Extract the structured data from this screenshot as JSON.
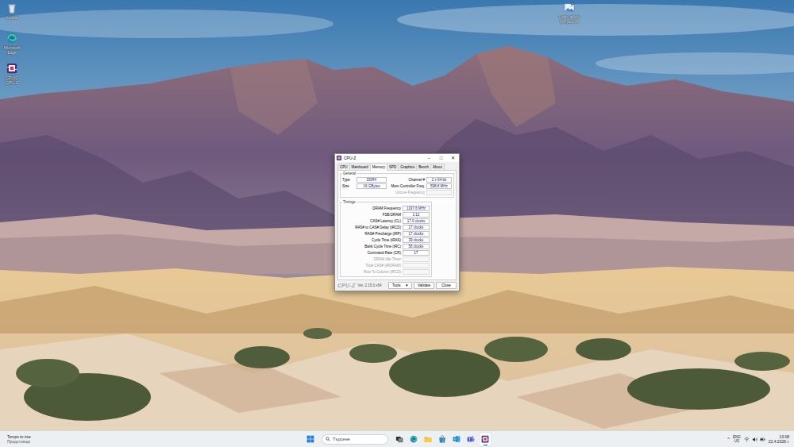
{
  "desktop": {
    "icons": [
      {
        "label": "Кошче",
        "kind": "recycle-bin"
      },
      {
        "label": "Microsoft Edge",
        "kind": "edge"
      },
      {
        "label": "CPUID CPU-Z",
        "kind": "cpuz"
      }
    ],
    "spotlight": {
      "label": "Learn about this picture"
    }
  },
  "window": {
    "title": "CPU-Z",
    "controls": [
      "–",
      "□",
      "✕"
    ]
  },
  "tabs": [
    {
      "label": "CPU",
      "selected": false
    },
    {
      "label": "Mainboard",
      "selected": false
    },
    {
      "label": "Memory",
      "selected": true
    },
    {
      "label": "SPD",
      "selected": false
    },
    {
      "label": "Graphics",
      "selected": false
    },
    {
      "label": "Bench",
      "selected": false
    },
    {
      "label": "About",
      "selected": false
    }
  ],
  "general": {
    "title": "General",
    "pairs": [
      {
        "left": {
          "label": "Type",
          "value": "DDR4"
        },
        "right": {
          "label": "Channel #",
          "value": "2 x 64-bit"
        }
      },
      {
        "left": {
          "label": "Size",
          "value": "16 GBytes"
        },
        "right": {
          "label": "Mem Controller Freq.",
          "value": "598.8 MHz"
        }
      }
    ],
    "extra": {
      "label": "Uncore Frequency",
      "value": "",
      "disabled": true
    }
  },
  "timings": {
    "title": "Timings",
    "rows": [
      {
        "label": "DRAM Frequency",
        "value": "1197.6 MHz",
        "disabled": false
      },
      {
        "label": "FSB:DRAM",
        "value": "1:12",
        "disabled": false
      },
      {
        "label": "CAS# Latency (CL)",
        "value": "17.0 clocks",
        "disabled": false
      },
      {
        "label": "RAS# to CAS# Delay (tRCD)",
        "value": "17 clocks",
        "disabled": false
      },
      {
        "label": "RAS# Precharge (tRP)",
        "value": "17 clocks",
        "disabled": false
      },
      {
        "label": "Cycle Time (tRAS)",
        "value": "39 clocks",
        "disabled": false
      },
      {
        "label": "Bank Cycle Time (tRC)",
        "value": "56 clocks",
        "disabled": false
      },
      {
        "label": "Command Rate (CR)",
        "value": "1T",
        "disabled": false
      },
      {
        "label": "DRAM Idle Timer",
        "value": "",
        "disabled": true
      },
      {
        "label": "Total CAS# (tRDRAM)",
        "value": "",
        "disabled": true
      },
      {
        "label": "Row To Column (tRCD)",
        "value": "",
        "disabled": true
      }
    ]
  },
  "footer": {
    "brand": "CPU-Z",
    "version": "Ver. 2.15.0.x64",
    "buttons": [
      {
        "label": "Tools",
        "arrow": "▾"
      },
      {
        "label": "Validate",
        "arrow": ""
      },
      {
        "label": "Close",
        "arrow": ""
      }
    ]
  },
  "taskbar": {
    "weather": {
      "title": "Temps to rise",
      "subtitle": "Предстоящо"
    },
    "search": {
      "placeholder": "Търсене"
    },
    "apps": [
      {
        "kind": "task-view",
        "running": false,
        "active": false
      },
      {
        "kind": "edge",
        "running": false,
        "active": false
      },
      {
        "kind": "explorer",
        "running": false,
        "active": false
      },
      {
        "kind": "store",
        "running": false,
        "active": false
      },
      {
        "kind": "outlook",
        "running": false,
        "active": false
      },
      {
        "kind": "teams",
        "running": false,
        "active": false
      },
      {
        "kind": "cpuz",
        "running": true,
        "active": true
      }
    ],
    "tray": {
      "chevron": "^",
      "language": "ENG",
      "layout": "US",
      "time": "13:08",
      "date": "22.4.2026 г."
    }
  }
}
